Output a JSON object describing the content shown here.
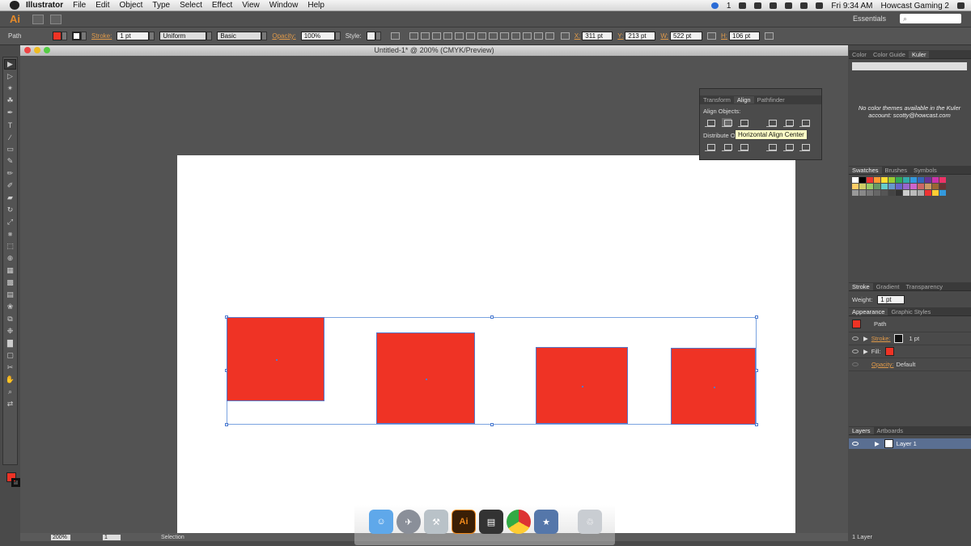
{
  "menubar": {
    "app": "Illustrator",
    "items": [
      "File",
      "Edit",
      "Object",
      "Type",
      "Select",
      "Effect",
      "View",
      "Window",
      "Help"
    ],
    "clock": "Fri 9:34 AM",
    "user": "Howcast Gaming 2",
    "badge": "1"
  },
  "appbar": {
    "logo": "Ai",
    "workspace": "Essentials"
  },
  "control": {
    "path": "Path",
    "stroke_label": "Stroke:",
    "stroke_val": "1 pt",
    "profile": "Uniform",
    "brush": "Basic",
    "opacity_label": "Opacity:",
    "opacity_val": "100%",
    "style_label": "Style:",
    "x_label": "X:",
    "x_val": "311 pt",
    "y_label": "Y:",
    "y_val": "213 pt",
    "w_label": "W:",
    "w_val": "522 pt",
    "h_label": "H:",
    "h_val": "106 pt"
  },
  "document": {
    "title": "Untitled-1* @ 200% (CMYK/Preview)",
    "zoom": "200%",
    "page": "1",
    "status": "Selection"
  },
  "align_panel": {
    "tabs": [
      "Transform",
      "Align",
      "Pathfinder"
    ],
    "align_label": "Align Objects:",
    "distribute_label": "Distribute O",
    "tooltip": "Horizontal Align Center"
  },
  "kuler": {
    "tabs": [
      "Color",
      "Color Guide",
      "Kuler"
    ],
    "message": "No color themes available in the Kuler account: scotty@howcast.com"
  },
  "swatches": {
    "tabs": [
      "Swatches",
      "Brushes",
      "Symbols"
    ]
  },
  "stroke_panel": {
    "tabs": [
      "Stroke",
      "Gradient",
      "Transparency"
    ],
    "weight_label": "Weight:",
    "weight_val": "1 pt"
  },
  "appearance": {
    "tabs": [
      "Appearance",
      "Graphic Styles"
    ],
    "title": "Path",
    "stroke_label": "Stroke:",
    "stroke_val": "1 pt",
    "fill_label": "Fill:",
    "opacity_label": "Opacity:",
    "opacity_val": "Default"
  },
  "layers": {
    "tabs": [
      "Layers",
      "Artboards"
    ],
    "layer1": "Layer 1",
    "count": "1 Layer"
  },
  "colors": {
    "fill": "#ef3325",
    "accent": "#e09a4a"
  },
  "dock": {
    "items": [
      "finder-icon",
      "rocket-icon",
      "preview-icon",
      "illustrator-icon",
      "claquette-icon",
      "chrome-icon",
      "imovie-icon",
      "trash-icon"
    ]
  }
}
